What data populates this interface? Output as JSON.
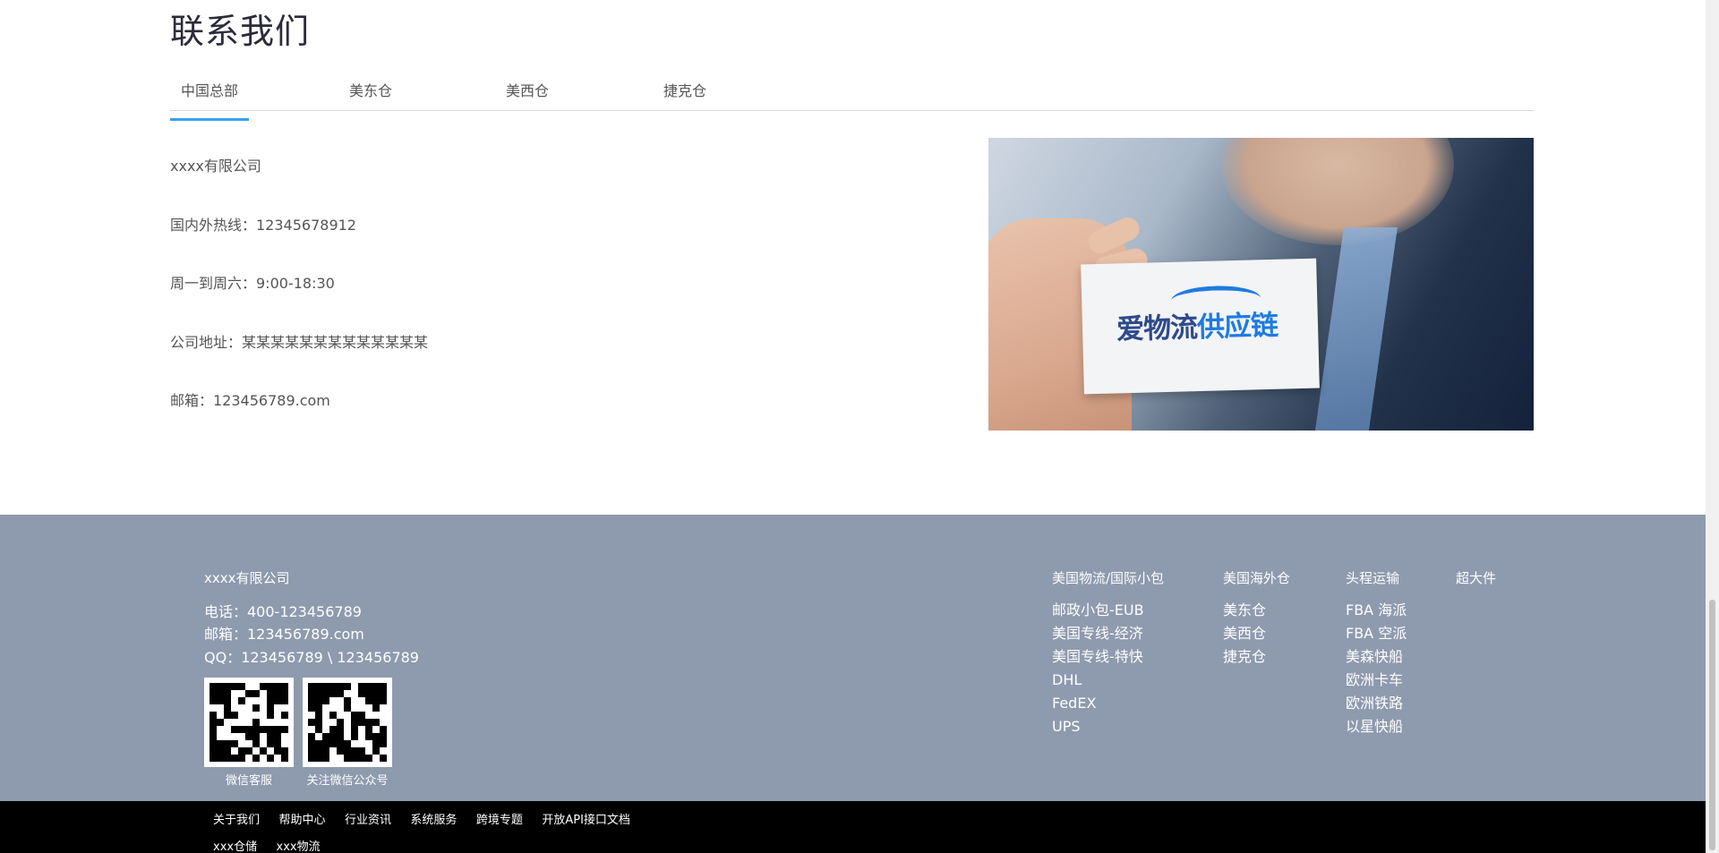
{
  "contact": {
    "title": "联系我们",
    "tabs": [
      "中国总部",
      "美东仓",
      "美西仓",
      "捷克仓"
    ],
    "info": [
      "xxxx有限公司",
      "国内外热线：12345678912",
      "周一到周六：9:00-18:30",
      "公司地址：某某某某某某某某某某某某某",
      "邮箱：123456789.com"
    ],
    "card_logo_part1": "爱物流",
    "card_logo_part2": "供应链"
  },
  "footer": {
    "company": "xxxx有限公司",
    "phone": "电话：400-123456789",
    "email": "邮箱：123456789.com",
    "qq": "QQ：123456789 \\ 123456789",
    "qr_captions": [
      "微信客服",
      "关注微信公众号"
    ],
    "columns": [
      {
        "head": "美国物流/国际小包",
        "items": [
          "邮政小包-EUB",
          "美国专线-经济",
          "美国专线-特快",
          "DHL",
          "FedEX",
          "UPS"
        ]
      },
      {
        "head": "美国海外仓",
        "items": [
          "美东仓",
          "美西仓",
          "捷克仓"
        ]
      },
      {
        "head": "头程运输",
        "items": [
          "FBA 海派",
          "FBA 空派",
          "美森快船",
          "欧洲卡车",
          "欧洲铁路",
          "以星快船"
        ]
      },
      {
        "head": "超大件",
        "items": []
      }
    ]
  },
  "bottom_links": [
    "关于我们",
    "帮助中心",
    "行业资讯",
    "系统服务",
    "跨境专题",
    "开放API接口文档"
  ],
  "bottom_links_row2": [
    "xxx仓储",
    "xxx物流"
  ],
  "colors": {
    "accent": "#3aa0f0",
    "footer_bg": "#8e9aae",
    "bottom_bg": "#000000"
  }
}
